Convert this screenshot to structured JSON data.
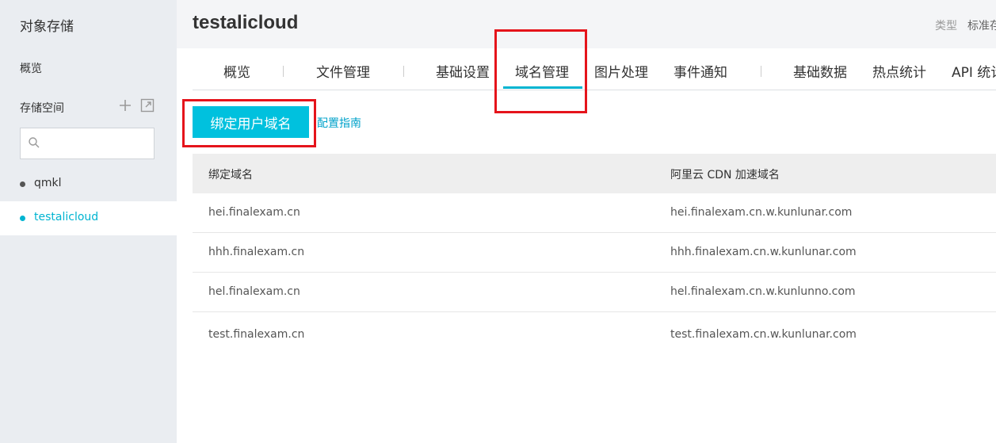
{
  "sidebar": {
    "title": "对象存储",
    "overview": "概览",
    "storage_label": "存储空间",
    "search": {
      "placeholder": ""
    },
    "buckets": [
      {
        "name": "qmkl",
        "active": false
      },
      {
        "name": "testalicloud",
        "active": true
      }
    ]
  },
  "header": {
    "bucket_name": "testalicloud",
    "type_label": "类型",
    "type_value": "标准存"
  },
  "tabs": [
    "概览",
    "文件管理",
    "基础设置",
    "域名管理",
    "图片处理",
    "事件通知",
    "基础数据",
    "热点统计",
    "API 统计"
  ],
  "active_tab": "域名管理",
  "actions": {
    "bind_domain": "绑定用户域名",
    "config_guide": "配置指南"
  },
  "table": {
    "columns": [
      "绑定域名",
      "阿里云 CDN 加速域名"
    ],
    "rows": [
      [
        "hei.finalexam.cn",
        "hei.finalexam.cn.w.kunlunar.com"
      ],
      [
        "hhh.finalexam.cn",
        "hhh.finalexam.cn.w.kunlunar.com"
      ],
      [
        "hel.finalexam.cn",
        "hel.finalexam.cn.w.kunlunno.com"
      ],
      [
        "test.finalexam.cn",
        "test.finalexam.cn.w.kunlunar.com"
      ]
    ]
  },
  "colors": {
    "accent": "#00c1de",
    "link": "#00a2ca",
    "highlight": "#e5141b",
    "sidebar_bg": "#eaedf1"
  }
}
